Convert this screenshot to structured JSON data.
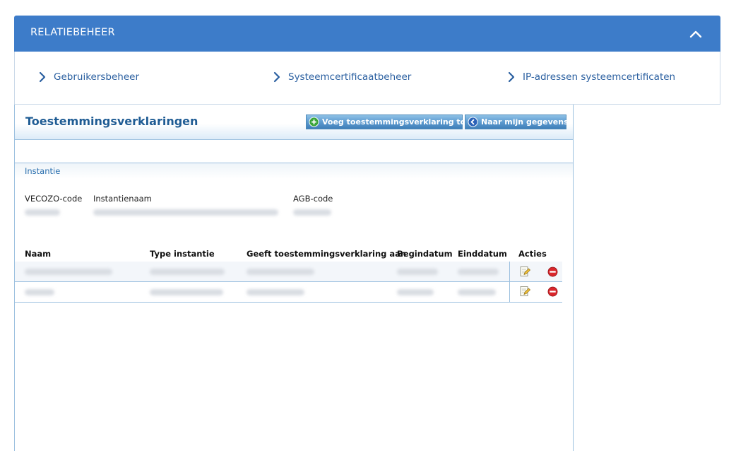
{
  "panel": {
    "title": "RELATIEBEHEER",
    "links": [
      "Gebruikersbeheer",
      "Systeemcertificaatbeheer",
      "IP-adressen systeemcertificaten"
    ]
  },
  "content": {
    "title": "Toestemmingsverklaringen",
    "buttons": {
      "add": "Voeg toestemmingsverklaring toe",
      "back": "Naar mijn gegevens"
    },
    "section": {
      "title": "Instantie",
      "fields": [
        "VECOZO-code",
        "Instantienaam",
        "AGB-code"
      ]
    },
    "table": {
      "headers": [
        "Naam",
        "Type instantie",
        "Geeft toestemmingsverklaring aan",
        "Begindatum",
        "Einddatum",
        "Acties"
      ]
    }
  },
  "colors": {
    "header_blue": "#3d7cc9",
    "link_blue": "#2a5fa0",
    "border_blue": "#9cc0df"
  }
}
